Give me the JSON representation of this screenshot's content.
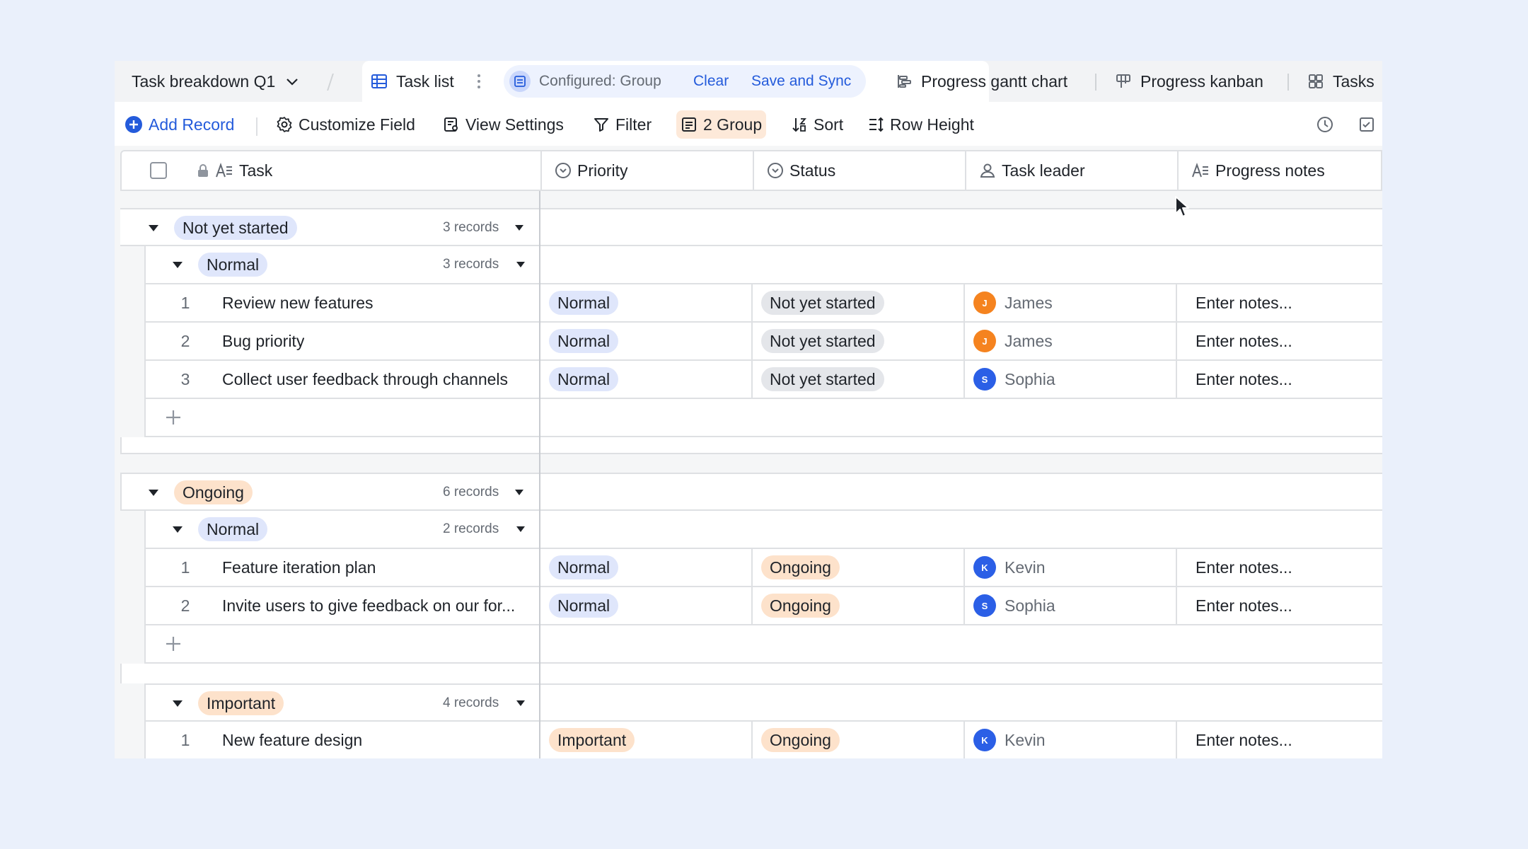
{
  "viewbar": {
    "table_name": "Task breakdown Q1",
    "active_view": "Task list",
    "configured_label": "Configured: Group",
    "clear_label": "Clear",
    "save_label": "Save and Sync",
    "other_views": [
      "Progress gantt chart",
      "Progress kanban",
      "Tasks"
    ]
  },
  "toolbar": {
    "add_record": "Add Record",
    "customize_field": "Customize Field",
    "view_settings": "View Settings",
    "filter": "Filter",
    "group": "2 Group",
    "sort": "Sort",
    "row_height": "Row Height"
  },
  "columns": {
    "task": "Task",
    "priority": "Priority",
    "status": "Status",
    "task_leader": "Task leader",
    "progress_notes": "Progress notes"
  },
  "colors": {
    "accent": "#245bdb",
    "tag_blue": "#dfe6fb",
    "tag_orange": "#fde2cb",
    "avatar_orange": "#f5831f",
    "avatar_blue": "#2b5fe6"
  },
  "groups": [
    {
      "label": "Not yet started",
      "count": "3 records",
      "subgroups": [
        {
          "label": "Normal",
          "count": "3 records",
          "rows": [
            {
              "num": "1",
              "task": "Review new features",
              "priority": "Normal",
              "status": "Not yet started",
              "leader": "James",
              "initial": "J",
              "notes": "Enter notes..."
            },
            {
              "num": "2",
              "task": "Bug priority",
              "priority": "Normal",
              "status": "Not yet started",
              "leader": "James",
              "initial": "J",
              "notes": "Enter notes..."
            },
            {
              "num": "3",
              "task": "Collect user feedback through channels",
              "priority": "Normal",
              "status": "Not yet started",
              "leader": "Sophia",
              "initial": "S",
              "notes": "Enter notes..."
            }
          ]
        }
      ]
    },
    {
      "label": "Ongoing",
      "count": "6 records",
      "subgroups": [
        {
          "label": "Normal",
          "count": "2 records",
          "rows": [
            {
              "num": "1",
              "task": "Feature iteration plan",
              "priority": "Normal",
              "status": "Ongoing",
              "leader": "Kevin",
              "initial": "K",
              "notes": "Enter notes..."
            },
            {
              "num": "2",
              "task": "Invite users to give feedback on our for...",
              "priority": "Normal",
              "status": "Ongoing",
              "leader": "Sophia",
              "initial": "S",
              "notes": "Enter notes..."
            }
          ]
        },
        {
          "label": "Important",
          "count": "4 records",
          "rows": [
            {
              "num": "1",
              "task": "New feature design",
              "priority": "Important",
              "status": "Ongoing",
              "leader": "Kevin",
              "initial": "K",
              "notes": "Enter notes..."
            }
          ]
        }
      ]
    }
  ]
}
